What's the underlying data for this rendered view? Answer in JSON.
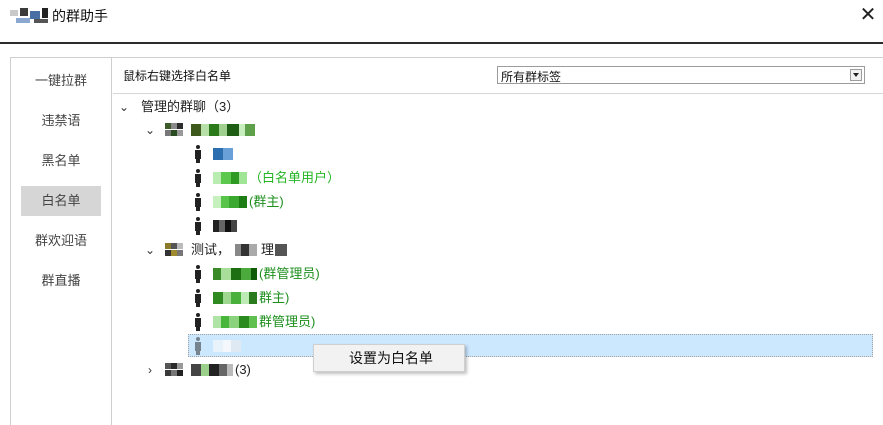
{
  "window": {
    "title": "的群助手",
    "close_glyph": "✕"
  },
  "sidebar": {
    "items": [
      {
        "label": "一键拉群"
      },
      {
        "label": "违禁语"
      },
      {
        "label": "黑名单"
      },
      {
        "label": "白名单",
        "active": true
      },
      {
        "label": "群欢迎语"
      },
      {
        "label": "群直播"
      }
    ]
  },
  "toolbar": {
    "hint": "鼠标右键选择白名单",
    "tag_select": {
      "value": "所有群标签"
    }
  },
  "tree": {
    "root": {
      "label": "管理的群聊（3）",
      "expanded": true
    },
    "groups": [
      {
        "expanded": true,
        "members": [
          {
            "suffix": ""
          },
          {
            "suffix": "（白名单用户）",
            "color": "#23b523"
          },
          {
            "suffix": "(群主)",
            "color": "#1d8f1d"
          },
          {
            "suffix": ""
          }
        ]
      },
      {
        "name_visible": "测试，",
        "name_visible2": "理",
        "expanded": true,
        "members": [
          {
            "suffix": "(群管理员)",
            "color": "#1d8f1d"
          },
          {
            "suffix": "群主)",
            "color": "#1d8f1d"
          },
          {
            "suffix": "群管理员)",
            "color": "#1d8f1d"
          },
          {
            "suffix": "",
            "selected": true
          }
        ]
      },
      {
        "suffix": "(3)",
        "expanded": false
      }
    ]
  },
  "context_menu": {
    "items": [
      {
        "label": "设置为白名单"
      }
    ]
  },
  "icons": {
    "expanded": "chevron-down-icon",
    "collapsed": "chevron-right-icon",
    "group": "group-avatar-icon",
    "member": "person-icon"
  }
}
